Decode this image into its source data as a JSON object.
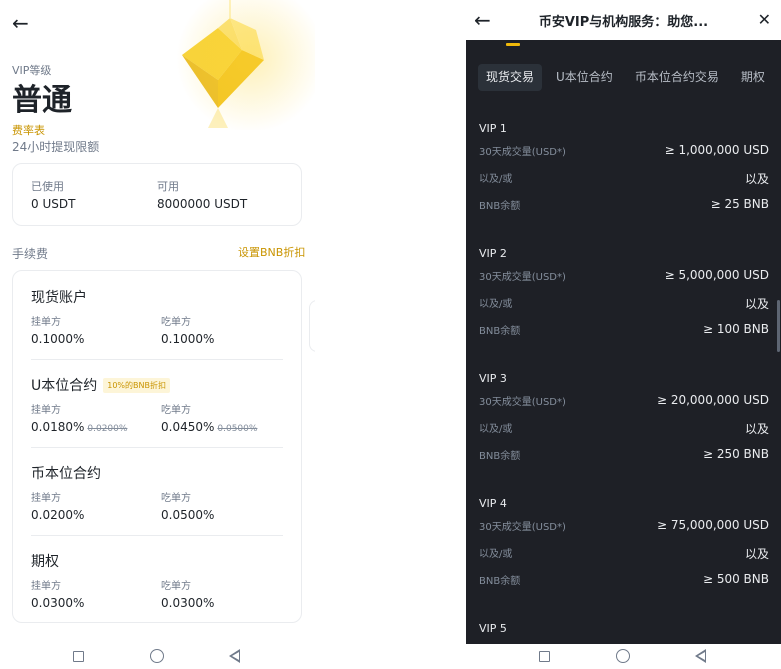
{
  "left": {
    "vip_label": "VIP等级",
    "vip_level": "普通",
    "fee_schedule_link": "费率表",
    "withdraw_limit_label": "24小时提现限额",
    "limit": {
      "used_label": "已使用",
      "used_value": "0 USDT",
      "available_label": "可用",
      "available_value": "8000000 USDT"
    },
    "fees_label": "手续费",
    "bnb_discount_link": "设置BNB折扣",
    "fee_sections": [
      {
        "title": "现货账户",
        "badge": "",
        "maker_label": "挂单方",
        "maker": "0.1000%",
        "maker_old": "",
        "taker_label": "吃单方",
        "taker": "0.1000%",
        "taker_old": ""
      },
      {
        "title": "U本位合约",
        "badge": "10%的BNB折扣",
        "maker_label": "挂单方",
        "maker": "0.0180%",
        "maker_old": "0.0200%",
        "taker_label": "吃单方",
        "taker": "0.0450%",
        "taker_old": "0.0500%"
      },
      {
        "title": "币本位合约",
        "badge": "",
        "maker_label": "挂单方",
        "maker": "0.0200%",
        "maker_old": "",
        "taker_label": "吃单方",
        "taker": "0.0500%",
        "taker_old": ""
      },
      {
        "title": "期权",
        "badge": "",
        "maker_label": "挂单方",
        "maker": "0.0300%",
        "maker_old": "",
        "taker_label": "吃单方",
        "taker": "0.0300%",
        "taker_old": ""
      }
    ]
  },
  "right": {
    "title": "币安VIP与机构服务：助您...",
    "close_glyph": "✕",
    "tabs": [
      "现货交易",
      "U本位合约",
      "币本位合约交易",
      "期权"
    ],
    "active_tab": 0,
    "vip_tiers": [
      {
        "name": "VIP 1",
        "volume_label": "30天成交量(USD*)",
        "volume": "≥ 1,000,000 USD",
        "or_label": "以及/或",
        "or_value": "以及",
        "bnb_label": "BNB余额",
        "bnb": "≥ 25 BNB"
      },
      {
        "name": "VIP 2",
        "volume_label": "30天成交量(USD*)",
        "volume": "≥ 5,000,000 USD",
        "or_label": "以及/或",
        "or_value": "以及",
        "bnb_label": "BNB余额",
        "bnb": "≥ 100 BNB"
      },
      {
        "name": "VIP 3",
        "volume_label": "30天成交量(USD*)",
        "volume": "≥ 20,000,000 USD",
        "or_label": "以及/或",
        "or_value": "以及",
        "bnb_label": "BNB余额",
        "bnb": "≥ 250 BNB"
      },
      {
        "name": "VIP 4",
        "volume_label": "30天成交量(USD*)",
        "volume": "≥ 75,000,000 USD",
        "or_label": "以及/或",
        "or_value": "以及",
        "bnb_label": "BNB余额",
        "bnb": "≥ 500 BNB"
      },
      {
        "name": "VIP 5"
      }
    ]
  },
  "icons": {
    "back": "back-arrow-icon",
    "diamond": "vip-diamond-icon",
    "nav": [
      "recents-square-icon",
      "home-circle-icon",
      "back-triangle-icon"
    ]
  },
  "colors": {
    "accent": "#f0b90b",
    "link": "#c99400",
    "dark_bg": "#1e2026",
    "tab_active_bg": "#2b3139"
  }
}
